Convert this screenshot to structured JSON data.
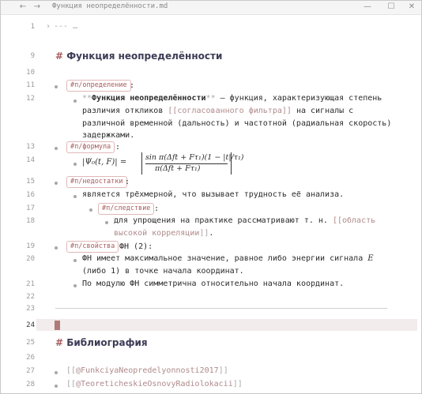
{
  "window": {
    "title": "Функция неопределённости.md",
    "back": "←",
    "forward": "→",
    "minimize": "—",
    "maximize": "☐",
    "close": "✕"
  },
  "lines": {
    "l1": {
      "num": "1",
      "text": "--- …"
    },
    "l9": {
      "num": "9",
      "hash": "#",
      "heading": "Функция неопределённости"
    },
    "l10": {
      "num": "10"
    },
    "l11": {
      "num": "11",
      "tag": "#п/определение",
      "after": ":"
    },
    "l12": {
      "num": "12",
      "stars_open": "**",
      "bold": "Функция неопределённости",
      "stars_close": "**",
      "rest1": " — функция, характеризующая степень",
      "line2a": "различия откликов ",
      "link": "[[согласованного фильтра]]",
      "line2b": " на сигналы с",
      "line3": "различной временной (дальность) и частотной (радиальная скорость)",
      "line4": "задержками."
    },
    "l13": {
      "num": "13",
      "tag": "#п/формула",
      "after": ":"
    },
    "l14": {
      "num": "14",
      "lhs": "|Ψ₀(t, F)| =",
      "numerator": "sin π(Δft + Fτ₁)(1 − |t|/τ₁)",
      "denominator": "π(Δft + Fτ₁)"
    },
    "l15": {
      "num": "15",
      "tag": "#п/недостатки",
      "after": ":"
    },
    "l16": {
      "num": "16",
      "text": "является трёхмерной, что вызывает трудность её анализа."
    },
    "l17": {
      "num": "17",
      "tag": "#п/следствие",
      "after": ":"
    },
    "l18": {
      "num": "18",
      "text1": "для упрощения на практике рассматривают т. н. ",
      "link1": "[[область",
      "link2": "высокой корреляции",
      "link3": "]]",
      "end": "."
    },
    "l19": {
      "num": "19",
      "tag": "#п/свойства",
      "after": " ФН (2):"
    },
    "l20": {
      "num": "20",
      "text1": "ФН имеет максимальное значение, равное либо энергии сигнала ",
      "var": "E",
      "text2": "(либо 1) в точке начала координат."
    },
    "l21": {
      "num": "21",
      "text": "По модулю ФН симметрична относительно начала координат."
    },
    "l22": {
      "num": "22"
    },
    "l23": {
      "num": "23"
    },
    "l24": {
      "num": "24"
    },
    "l25": {
      "num": "25",
      "hash": "#",
      "heading": "Библиография"
    },
    "l26": {
      "num": "26"
    },
    "l27": {
      "num": "27",
      "open": "[[",
      "cite": "@FunkciyaNeopredelyonnosti2017",
      "close": "]]"
    },
    "l28": {
      "num": "28",
      "open": "[[",
      "cite": "@TeoreticheskieOsnovyRadiolokacii",
      "close": "]]"
    }
  }
}
